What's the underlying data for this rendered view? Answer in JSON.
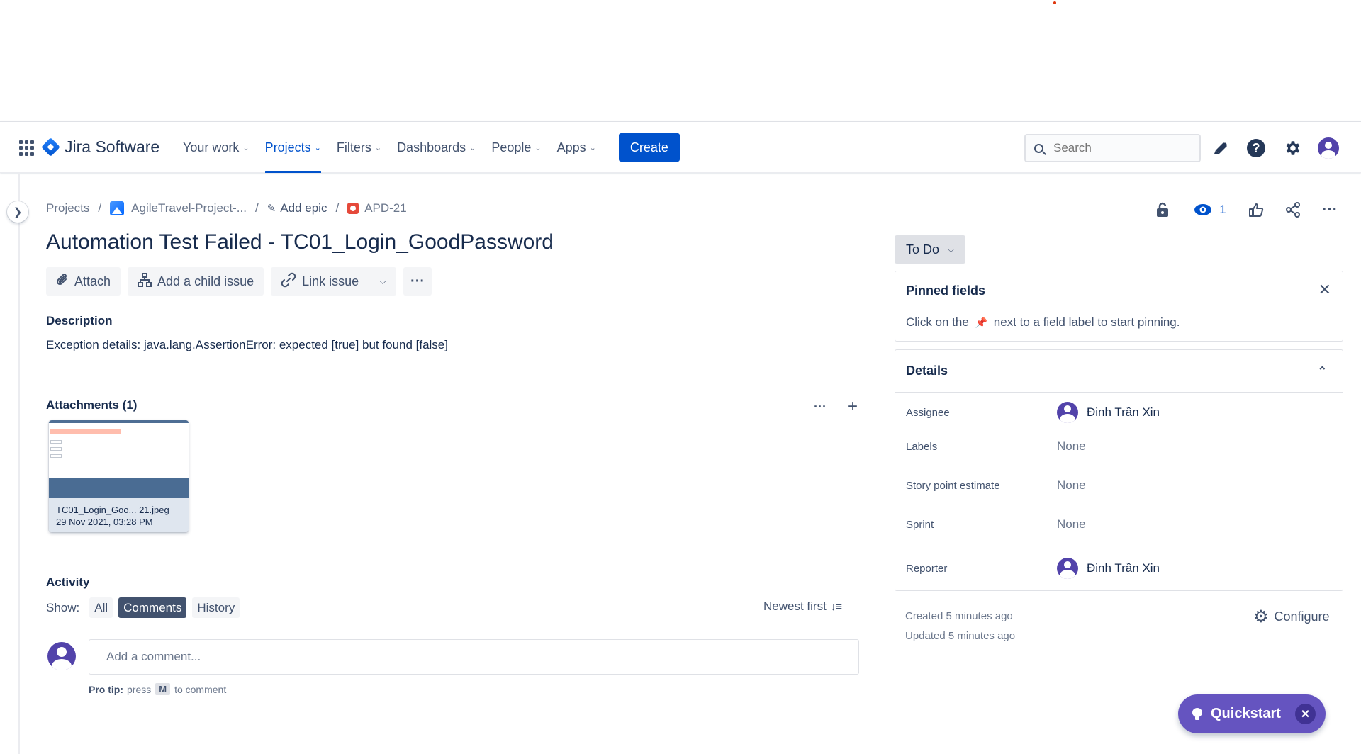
{
  "topbar": {
    "logo_text": "Jira Software",
    "nav": [
      {
        "label": "Your work"
      },
      {
        "label": "Projects"
      },
      {
        "label": "Filters"
      },
      {
        "label": "Dashboards"
      },
      {
        "label": "People"
      },
      {
        "label": "Apps"
      }
    ],
    "create_label": "Create",
    "search_placeholder": "Search"
  },
  "breadcrumb": {
    "projects": "Projects",
    "project": "AgileTravel-Project-...",
    "add_epic": "Add epic",
    "issue_key": "APD-21"
  },
  "header_actions": {
    "watch_count": "1"
  },
  "issue": {
    "title": "Automation Test Failed - TC01_Login_GoodPassword",
    "toolbar": {
      "attach": "Attach",
      "add_child": "Add a child issue",
      "link_issue": "Link issue"
    },
    "description_label": "Description",
    "description": "Exception details: java.lang.AssertionError: expected [true] but found [false]",
    "attachments_label": "Attachments (1)",
    "attachment": {
      "name": "TC01_Login_Goo... 21.jpeg",
      "date": "29 Nov 2021, 03:28 PM"
    }
  },
  "activity": {
    "label": "Activity",
    "show_label": "Show:",
    "filters": [
      "All",
      "Comments",
      "History"
    ],
    "selected_filter": "Comments",
    "sort": "Newest first",
    "comment_placeholder": "Add a comment...",
    "protip_bold": "Pro tip:",
    "protip_press": "press",
    "protip_key": "M",
    "protip_suffix": "to comment"
  },
  "sidebar": {
    "status": "To Do",
    "pinned": {
      "title": "Pinned fields",
      "text_before": "Click on the",
      "text_after": "next to a field label to start pinning."
    },
    "details": {
      "title": "Details",
      "fields": [
        {
          "label": "Assignee",
          "value": "Đinh Trần Xin"
        },
        {
          "label": "Labels",
          "value": "None"
        },
        {
          "label": "Story point estimate",
          "value": "None"
        },
        {
          "label": "Sprint",
          "value": "None"
        },
        {
          "label": "Reporter",
          "value": "Đinh Trần Xin"
        }
      ]
    },
    "created": "Created 5 minutes ago",
    "updated": "Updated 5 minutes ago",
    "configure": "Configure"
  },
  "quickstart": {
    "label": "Quickstart"
  },
  "colors": {
    "brand": "#0052cc",
    "quickstart": "#6554c0",
    "avatar": "#5243aa"
  }
}
